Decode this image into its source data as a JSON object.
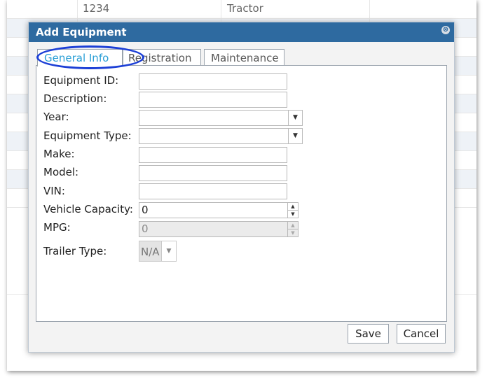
{
  "background_grid": {
    "first_row": {
      "id": "1234",
      "type": "Tractor"
    }
  },
  "dialog": {
    "title": "Add Equipment",
    "close_glyph": "⊗",
    "tabs": [
      {
        "label": "General Info",
        "active": true
      },
      {
        "label": "Registration",
        "active": false
      },
      {
        "label": "Maintenance",
        "active": false
      }
    ],
    "fields": {
      "equipment_id": {
        "label": "Equipment ID:",
        "value": ""
      },
      "description": {
        "label": "Description:",
        "value": ""
      },
      "year": {
        "label": "Year:",
        "value": ""
      },
      "equipment_type": {
        "label": "Equipment Type:",
        "value": ""
      },
      "make": {
        "label": "Make:",
        "value": ""
      },
      "model": {
        "label": "Model:",
        "value": ""
      },
      "vin": {
        "label": "VIN:",
        "value": ""
      },
      "vehicle_capacity": {
        "label": "Vehicle Capacity:",
        "value": "0"
      },
      "mpg": {
        "label": "MPG:",
        "value": "0"
      },
      "trailer_type": {
        "label": "Trailer Type:",
        "value": "N/A"
      }
    },
    "buttons": {
      "save": "Save",
      "cancel": "Cancel"
    }
  },
  "icons": {
    "dropdown": "▼",
    "spin_up": "▲",
    "spin_down": "▼"
  },
  "colors": {
    "titlebar": "#2e6aa0",
    "active_tab_text": "#2a9fd6",
    "highlight_oval": "#1c3fd6"
  }
}
